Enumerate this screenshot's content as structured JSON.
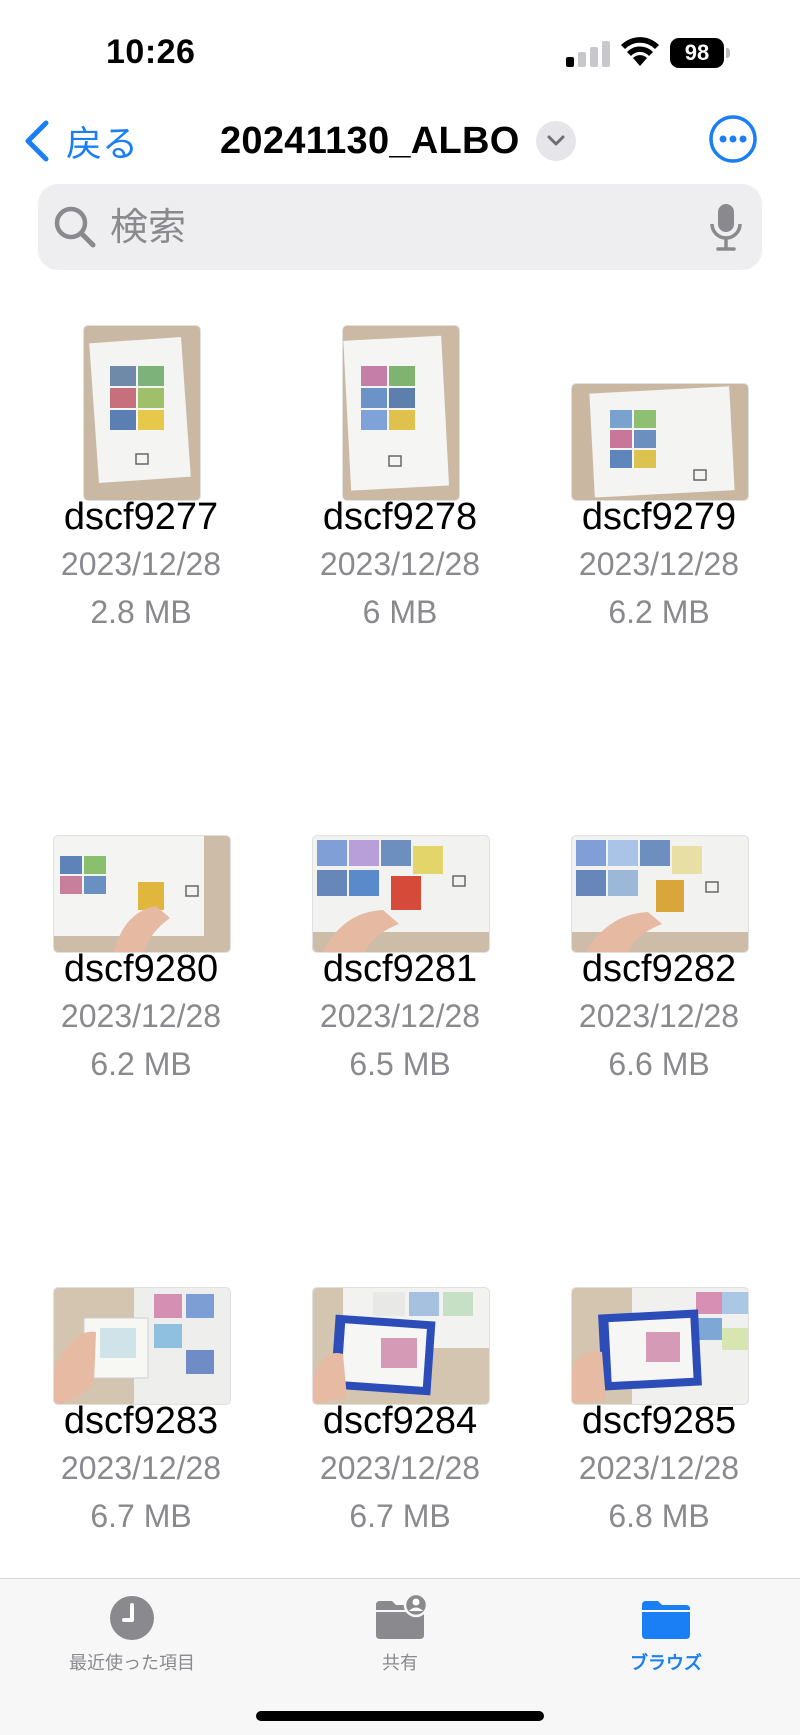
{
  "status": {
    "time": "10:26",
    "battery": "98"
  },
  "nav": {
    "back_label": "戻る",
    "title": "20241130_ALBO"
  },
  "search": {
    "placeholder": "検索"
  },
  "files": [
    {
      "name": "dscf9277",
      "date": "2023/12/28",
      "size": "2.8 MB"
    },
    {
      "name": "dscf9278",
      "date": "2023/12/28",
      "size": "6 MB"
    },
    {
      "name": "dscf9279",
      "date": "2023/12/28",
      "size": "6.2 MB"
    },
    {
      "name": "dscf9280",
      "date": "2023/12/28",
      "size": "6.2 MB"
    },
    {
      "name": "dscf9281",
      "date": "2023/12/28",
      "size": "6.5 MB"
    },
    {
      "name": "dscf9282",
      "date": "2023/12/28",
      "size": "6.6 MB"
    },
    {
      "name": "dscf9283",
      "date": "2023/12/28",
      "size": "6.7 MB"
    },
    {
      "name": "dscf9284",
      "date": "2023/12/28",
      "size": "6.7 MB"
    },
    {
      "name": "dscf9285",
      "date": "2023/12/28",
      "size": "6.8 MB"
    }
  ],
  "tabs": [
    {
      "label": "最近使った項目",
      "icon": "clock-icon"
    },
    {
      "label": "共有",
      "icon": "shared-folder-icon"
    },
    {
      "label": "ブラウズ",
      "icon": "folder-icon"
    }
  ],
  "colors": {
    "accent": "#1a7ef5",
    "secondary_text": "#8a8a8e"
  }
}
